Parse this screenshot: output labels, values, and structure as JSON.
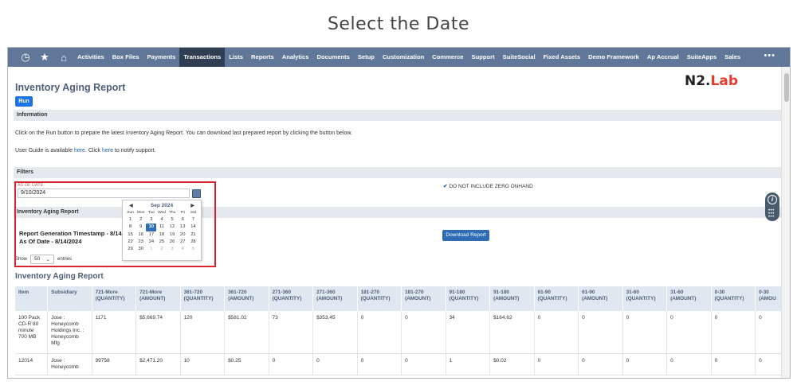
{
  "heading": "Select the Date",
  "nav": {
    "icons": [
      "history-icon",
      "star-icon",
      "home-icon"
    ],
    "items": [
      "Activities",
      "Box Files",
      "Payments",
      "Transactions",
      "Lists",
      "Reports",
      "Analytics",
      "Documents",
      "Setup",
      "Customization",
      "Commerce",
      "Support",
      "SuiteSocial",
      "Fixed Assets",
      "Demo Framework",
      "Ap Accrual",
      "SuiteApps",
      "Sales"
    ],
    "active": "Transactions",
    "more": "•••"
  },
  "logo": {
    "part1": "N2.",
    "part2": "Lab"
  },
  "page": {
    "title": "Inventory Aging Report",
    "run_label": "Run",
    "information_label": "Information",
    "info_line1": "Click on the Run button to prepare the latest Inventory Aging Report. You can download last prepared report by clicking the button below.",
    "info_line2_a": "User Guide is available ",
    "info_line2_link1": "here",
    "info_line2_b": ". Click ",
    "info_line2_link2": "here",
    "info_line2_c": " to notify support.",
    "filters_label": "Filters",
    "as_of_date_label": "AS OF DATE",
    "as_of_date_value": "9/10/2024",
    "checkbox_label": "DO NOT INCLUDE ZERO ONHAND",
    "report_section_label": "Inventory Aging Report",
    "timestamp_line": "Report Generation Timestamp - 8/14/20",
    "as_of_line": "As Of Date - 8/14/2024",
    "download_label": "Download Report",
    "show_label": "Show",
    "show_value": "50",
    "entries_label": "entries",
    "table_title": "Inventory Aging Report"
  },
  "calendar": {
    "month_label": "Sep 2024",
    "dow": [
      "Sun",
      "Mon",
      "Tue",
      "Wed",
      "Thu",
      "Fri",
      "Sat"
    ],
    "days": [
      [
        "1",
        "2",
        "3",
        "4",
        "5",
        "6",
        "7"
      ],
      [
        "8",
        "9",
        "10",
        "11",
        "12",
        "13",
        "14"
      ],
      [
        "15",
        "16",
        "17",
        "18",
        "19",
        "20",
        "21"
      ],
      [
        "22",
        "23",
        "24",
        "25",
        "26",
        "27",
        "28"
      ],
      [
        "29",
        "30",
        "1",
        "2",
        "3",
        "4",
        "5"
      ]
    ],
    "selected": "10"
  },
  "table": {
    "headers": [
      "Item",
      "Subsidiary",
      "721-More (QUANTITY)",
      "721-More (AMOUNT)",
      "361-720 (QUANTITY)",
      "361-720 (AMOUNT)",
      "271-360 (QUANTITY)",
      "271-360 (AMOUNT)",
      "181-270 (QUANTITY)",
      "181-270 (AMOUNT)",
      "91-180 (QUANTITY)",
      "91-180 (AMOUNT)",
      "61-90 (QUANTITY)",
      "61-90 (AMOUNT)",
      "31-60 (QUANTITY)",
      "31-60 (AMOUNT)",
      "0-30 (QUANTITY)",
      "0-30 (AMOU"
    ],
    "rows": [
      [
        "100 Pack CD-R 80 minute 700 MB",
        "Jose : Honeycomb Holdings Inc. : Honeycomb Mfg",
        "1171",
        "$5,669.74",
        "120",
        "$581.02",
        "73",
        "$353.45",
        "0",
        "0",
        "34",
        "$164.62",
        "0",
        "0",
        "0",
        "0",
        "0",
        "0"
      ],
      [
        "12014",
        "Jose : Honeycomb",
        "99758",
        "$2,471.20",
        "10",
        "$0.25",
        "0",
        "0",
        "0",
        "0",
        "1",
        "$0.02",
        "0",
        "0",
        "0",
        "0",
        "0",
        "0"
      ]
    ]
  }
}
